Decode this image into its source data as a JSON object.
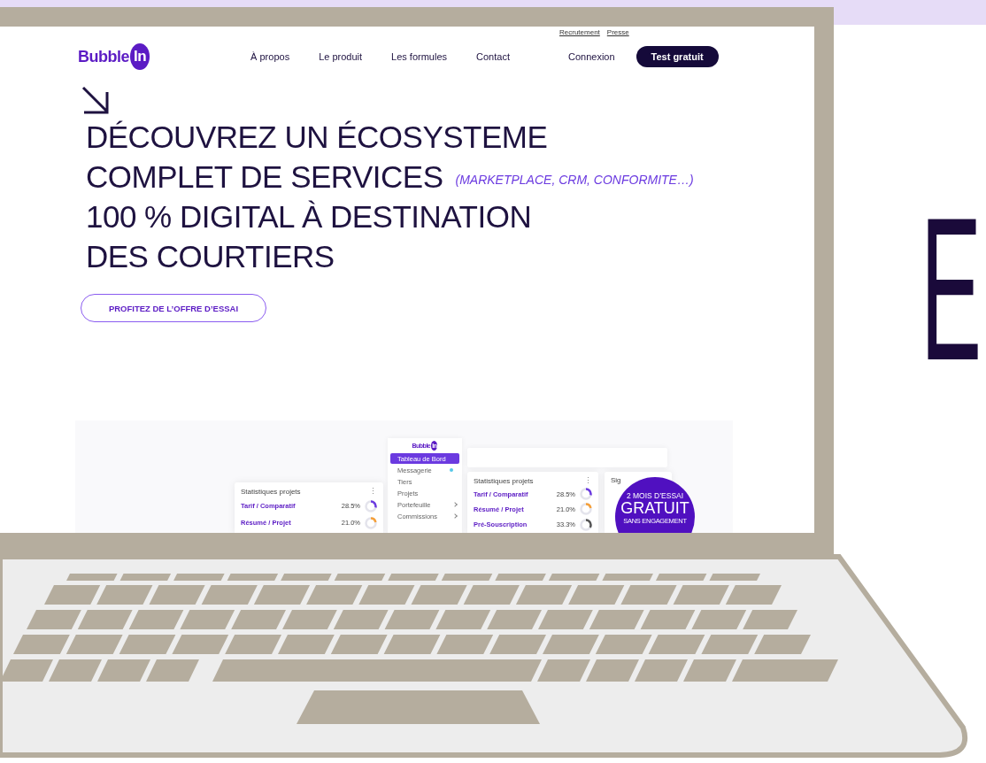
{
  "top_links": [
    {
      "label": "Recrutement"
    },
    {
      "label": "Presse"
    }
  ],
  "logo": {
    "text": "Bubble",
    "accent": "In"
  },
  "nav": [
    {
      "label": "À propos"
    },
    {
      "label": "Le produit"
    },
    {
      "label": "Les formules"
    },
    {
      "label": "Contact"
    }
  ],
  "login": "Connexion",
  "cta": "Test gratuit",
  "hero": {
    "lines": [
      "DÉCOUVREZ UN ÉCOSYSTEME",
      "COMPLET DE SERVICES",
      "100 % DIGITAL À DESTINATION",
      "DES COURTIERS"
    ],
    "aside": "(MARKETPLACE, CRM, CONFORMITE…)",
    "button": "PROFITEZ DE L’OFFRE D’ESSAI"
  },
  "preview": {
    "sidebar": {
      "logo": {
        "text": "Bubble",
        "accent": "In"
      },
      "items": [
        {
          "label": "Tableau de Bord",
          "selected": true,
          "unread": false,
          "expandable": false
        },
        {
          "label": "Messagerie",
          "selected": false,
          "unread": true,
          "expandable": false
        },
        {
          "label": "Tiers",
          "selected": false,
          "unread": false,
          "expandable": false
        },
        {
          "label": "Projets",
          "selected": false,
          "unread": false,
          "expandable": false
        },
        {
          "label": "Portefeuille",
          "selected": false,
          "unread": false,
          "expandable": true
        },
        {
          "label": "Commissions",
          "selected": false,
          "unread": false,
          "expandable": true
        }
      ]
    },
    "cards": [
      {
        "kind": "stats",
        "title": "Statistiques projets",
        "menu": "⋮",
        "rows": [
          {
            "label": "Tarif / Comparatif",
            "value": "28.5%",
            "level": 0.285,
            "color": "#6b3ae0"
          },
          {
            "label": "Résumé / Projet",
            "value": "21.0%",
            "level": 0.21,
            "color": "#f5a03a"
          }
        ]
      },
      {
        "kind": "stats",
        "title": "Statistiques projets",
        "menu": "⋮",
        "rows": [
          {
            "label": "Tarif / Comparatif",
            "value": "28.5%",
            "level": 0.285,
            "color": "#6b3ae0"
          },
          {
            "label": "Résumé / Projet",
            "value": "21.0%",
            "level": 0.21,
            "color": "#f5a03a"
          },
          {
            "label": "Pré-Souscription",
            "value": "33.3%",
            "level": 0.333,
            "color": "#555555"
          }
        ]
      },
      {
        "kind": "partial",
        "title": "Sig"
      }
    ],
    "badge": {
      "top": "2 MOIS D’ESSAI",
      "main": "GRATUIT",
      "bottom": "SANS ENGAGEMENT"
    }
  },
  "side_letter": "E"
}
